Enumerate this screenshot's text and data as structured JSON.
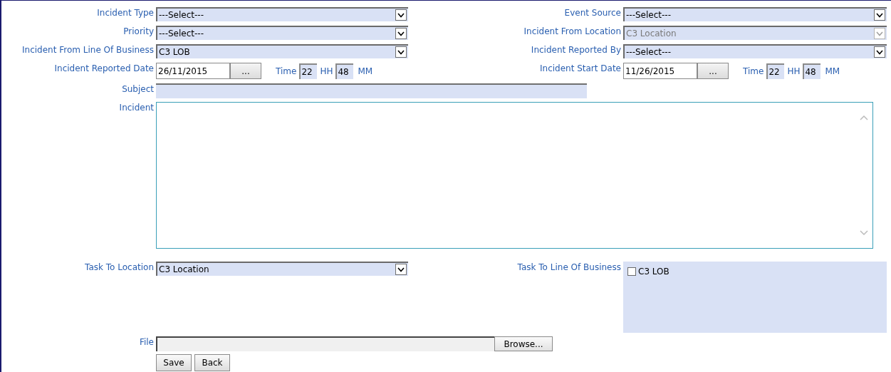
{
  "rows": [
    {
      "left": {
        "label": "Incident Type",
        "kind": "select",
        "value": "---Select---",
        "disabled": false
      },
      "right": {
        "label": "Event Source",
        "kind": "select",
        "value": "---Select---",
        "disabled": false
      }
    },
    {
      "left": {
        "label": "Priority",
        "kind": "select",
        "value": "---Select---",
        "disabled": false
      },
      "right": {
        "label": "Incident From Location",
        "kind": "select",
        "value": "C3 Location",
        "disabled": true
      }
    },
    {
      "left": {
        "label": "Incident From Line Of Business",
        "kind": "select",
        "value": "C3 LOB",
        "disabled": false
      },
      "right": {
        "label": "Incident Reported By",
        "kind": "select",
        "value": "---Select---",
        "disabled": false
      }
    },
    {
      "left": {
        "label": "Incident Reported Date",
        "kind": "date",
        "value": "26/11/2015",
        "button": "...",
        "time_label": "Time",
        "hours": "22",
        "hours_unit": "HH",
        "minutes": "48",
        "minutes_unit": "MM"
      },
      "right": {
        "label": "Incident Start Date",
        "kind": "date",
        "value": "11/26/2015",
        "button": "...",
        "time_label": "Time",
        "hours": "22",
        "hours_unit": "HH",
        "minutes": "48",
        "minutes_unit": "MM"
      }
    }
  ],
  "subject": {
    "label": "Subject"
  },
  "incident": {
    "label": "Incident"
  },
  "task_to_location": {
    "label": "Task To Location",
    "value": "C3 Location"
  },
  "task_to_lob": {
    "label": "Task To Line Of Business",
    "options": [
      {
        "label": "C3 LOB",
        "checked": false
      }
    ]
  },
  "file": {
    "label": "File",
    "button": "Browse..."
  },
  "buttons": [
    "Save",
    "Back"
  ]
}
